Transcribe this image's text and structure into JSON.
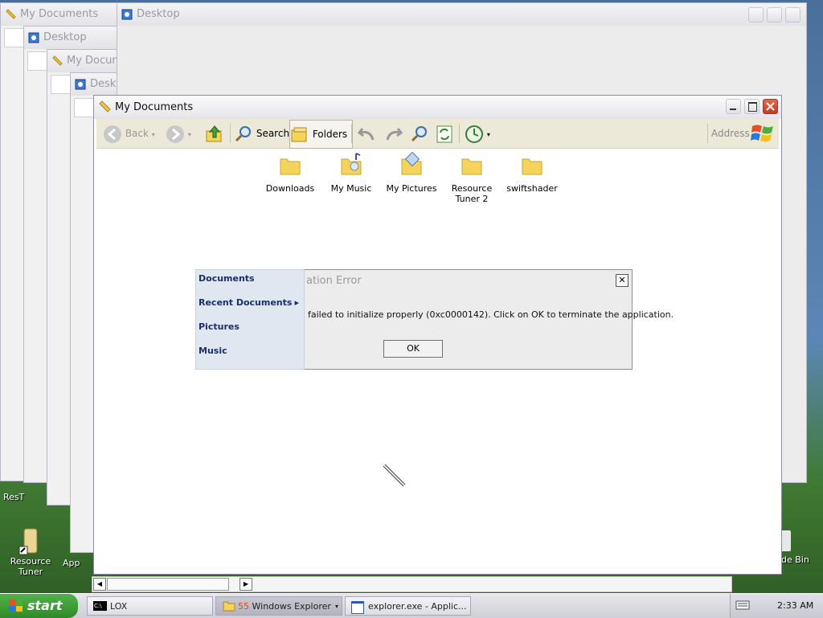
{
  "desktop": {
    "icons": [
      {
        "label_l1": "Resource",
        "label_l2": "Tuner"
      },
      {
        "label": "App"
      },
      {
        "label": "ResT"
      },
      {
        "label": "de Bin"
      }
    ]
  },
  "background_windows": [
    {
      "title": "My Documents"
    },
    {
      "title": "Desktop"
    },
    {
      "title": "My Docum"
    },
    {
      "title": "Deskt"
    },
    {
      "title": "Desktop"
    }
  ],
  "main_window": {
    "title": "My Documents",
    "toolbar": {
      "back": "Back",
      "search": "Search",
      "folders": "Folders",
      "address": "Address"
    },
    "folders": [
      {
        "label": "Downloads"
      },
      {
        "label": "My Music"
      },
      {
        "label": "My Pictures"
      },
      {
        "label_l1": "Resource",
        "label_l2": "Tuner 2"
      },
      {
        "label": "swiftshader"
      }
    ]
  },
  "error_dialog": {
    "title": "ation Error",
    "message": "failed to initialize properly (0xc0000142). Click on OK to terminate the application.",
    "ok_label": "OK",
    "close_glyph": "✕"
  },
  "start_menu": {
    "items": [
      {
        "label": "Documents"
      },
      {
        "label": "Recent Documents",
        "arrow": "▸"
      },
      {
        "label": "Pictures"
      },
      {
        "label": "Music"
      }
    ]
  },
  "taskbar": {
    "start_label": "start",
    "items": [
      {
        "label": "LOX",
        "icon_text": "C:\\"
      },
      {
        "label": "Windows Explorer",
        "count": "55"
      },
      {
        "label": "explorer.exe - Applic..."
      }
    ],
    "clock": "2:33 AM"
  },
  "colors": {
    "accent_green": "#2f8a29",
    "error_close_red": "#c9432a",
    "folder_yellow": "#f6d35a"
  }
}
